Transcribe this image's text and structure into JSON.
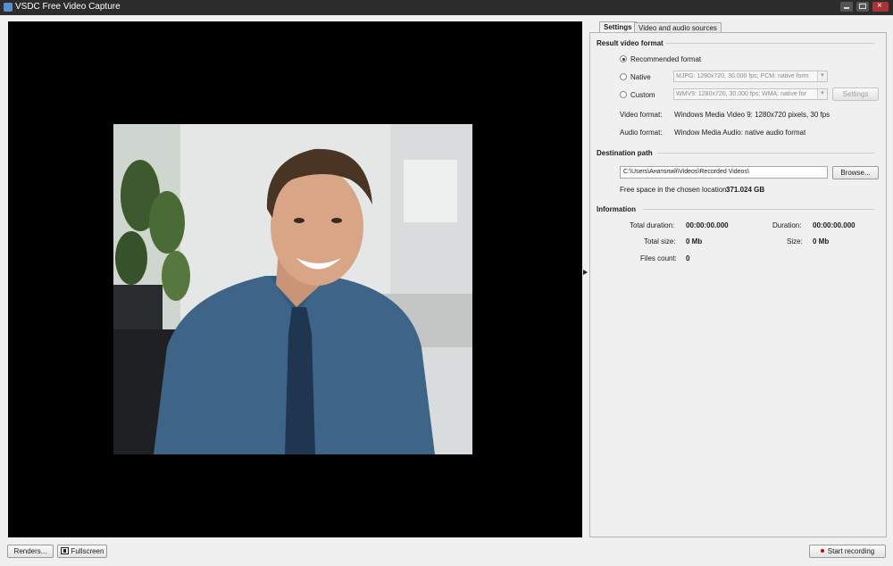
{
  "window": {
    "title": "VSDC Free Video Capture"
  },
  "tabs": [
    {
      "label": "Settings",
      "active": true
    },
    {
      "label": "Video and audio sources",
      "active": false
    }
  ],
  "result_format": {
    "heading": "Result video format",
    "options": [
      {
        "label": "Recommended format",
        "checked": true
      },
      {
        "label": "Native",
        "checked": false,
        "combo_value": "MJPG: 1280x720, 30.000 fps; PCM: native form"
      },
      {
        "label": "Custom",
        "checked": false,
        "combo_value": "WMV9: 1280x720, 30.000 fps; WMA: native for",
        "button": "Settings"
      }
    ],
    "video_format_label": "Video format:",
    "video_format_value": "Windows Media Video 9: 1280x720 pixels, 30 fps",
    "audio_format_label": "Audio format:",
    "audio_format_value": "Window Media Audio: native audio format"
  },
  "destination": {
    "heading": "Destination path",
    "path": "C:\\Users\\Анатолий\\Videos\\Recorded Videos\\",
    "browse_label": "Browse...",
    "free_space_label": "Free space in the chosen location:",
    "free_space_value": "371.024 GB"
  },
  "information": {
    "heading": "Information",
    "total_duration_label": "Total duration:",
    "total_duration_value": "00:00:00.000",
    "duration_label": "Duration:",
    "duration_value": "00:00:00.000",
    "total_size_label": "Total size:",
    "total_size_value": "0 Mb",
    "size_label": "Size:",
    "size_value": "0 Mb",
    "files_count_label": "Files count:",
    "files_count_value": "0"
  },
  "bottom": {
    "renders_label": "Renders...",
    "fullscreen_label": "Fullscreen",
    "start_recording_label": "Start recording"
  },
  "colors": {
    "titlebar": "#2c2c2c",
    "preview_bg": "#000000",
    "panel_bg": "#f0f0f0",
    "record_dot": "#d0021b",
    "shirt": "#3e6587"
  },
  "icons": [
    "app-icon",
    "minimize-icon",
    "maximize-icon",
    "close-icon",
    "fullscreen-icon",
    "record-dot-icon",
    "splitter-arrow-icon",
    "combo-arrow-icon"
  ]
}
